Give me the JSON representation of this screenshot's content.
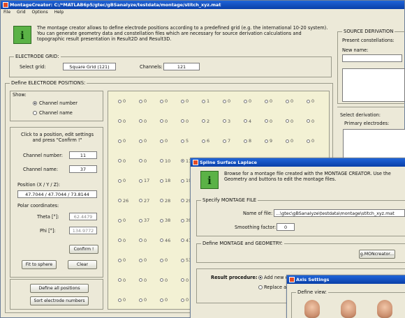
{
  "main_window": {
    "title": "MontageCreator: C:/*MATLAB6p5/gtec/gBSanalyze/testdata/montage/stitch_xyz.mat",
    "menu": [
      "File",
      "Grid",
      "Options",
      "Help"
    ],
    "info_text": "The montage creator allows to define electrode positions according to a predefined grid (e.g. the international 10-20 system). You can generate geometry data and constellation files which are necessary for source derivation calculations and topographic result presentation in Result2D and Result3D.",
    "electrode_grid": {
      "legend": "ELECTRODE GRID:",
      "select_grid_label": "Select grid:",
      "select_grid_value": "Square Grid (121)",
      "channels_label": "Channels:",
      "channels_value": "121"
    },
    "define_positions": {
      "legend": "Define ELECTRODE POSITIONS:",
      "show_label": "Show:",
      "show_options": [
        "Channel number",
        "Channel name"
      ],
      "show_selected": 0,
      "click_hint": "Click to a position, edit settings and press \"Confirm !\"",
      "channel_number_label": "Channel number:",
      "channel_number_value": "11",
      "channel_name_label": "Channel name:",
      "channel_name_value": "37",
      "position_label": "Position (X / Y / Z):",
      "position_value": "47.7044 / 47.7044 / 73.8144",
      "polar_label": "Polar coordinates:",
      "theta_label": "Theta [°]:",
      "theta_value": "62.4479",
      "phi_label": "Phi [°]:",
      "phi_value": "134.9772",
      "confirm_button": "Confirm !",
      "fit_sphere_button": "Fit to sphere",
      "clear_button": "Clear",
      "define_all_button": "Define all positions",
      "sort_button": "Sort electrode numbers"
    },
    "grid_rows": [
      [
        {
          "v": "0"
        },
        {
          "v": "0"
        },
        {
          "v": "0"
        },
        {
          "v": "0"
        },
        {
          "v": "1"
        },
        {
          "v": "0"
        },
        {
          "v": "0"
        },
        {
          "v": "0"
        },
        {
          "v": "0"
        },
        {
          "v": "0"
        }
      ],
      [
        {
          "v": "0"
        },
        {
          "v": "0"
        },
        {
          "v": "0"
        },
        {
          "v": "0"
        },
        {
          "v": "2"
        },
        {
          "v": "3"
        },
        {
          "v": "4"
        },
        {
          "v": "0"
        },
        {
          "v": "0"
        },
        {
          "v": "0"
        }
      ],
      [
        {
          "v": "0"
        },
        {
          "v": "0"
        },
        {
          "v": "0"
        },
        {
          "v": "5"
        },
        {
          "v": "6"
        },
        {
          "v": "7"
        },
        {
          "v": "8"
        },
        {
          "v": "9"
        },
        {
          "v": "0"
        },
        {
          "v": "0"
        }
      ],
      [
        {
          "v": "0"
        },
        {
          "v": "0"
        },
        {
          "v": "10"
        },
        {
          "v": "11",
          "on": true
        },
        {
          "v": "12"
        },
        {
          "v": "13"
        },
        {
          "v": "14"
        },
        {
          "v": "15"
        },
        {
          "v": "16"
        },
        {
          "v": "0"
        }
      ],
      [
        {
          "v": "0"
        },
        {
          "v": "17"
        },
        {
          "v": "18"
        },
        {
          "v": "19"
        }
      ],
      [
        {
          "v": "26"
        },
        {
          "v": "27"
        },
        {
          "v": "28"
        },
        {
          "v": "29"
        }
      ],
      [
        {
          "v": "0"
        },
        {
          "v": "37"
        },
        {
          "v": "38"
        },
        {
          "v": "39"
        }
      ],
      [
        {
          "v": "0"
        },
        {
          "v": "0"
        },
        {
          "v": "46"
        },
        {
          "v": "47"
        }
      ],
      [
        {
          "v": "0"
        },
        {
          "v": "0"
        },
        {
          "v": "0"
        },
        {
          "v": "53"
        }
      ],
      [
        {
          "v": "0"
        },
        {
          "v": "0"
        },
        {
          "v": "0"
        },
        {
          "v": "0"
        }
      ],
      [
        {
          "v": "0"
        },
        {
          "v": "0"
        },
        {
          "v": "0"
        },
        {
          "v": "0"
        }
      ]
    ],
    "source_derivation": {
      "legend": "SOURCE DERIVATION",
      "present_label": "Present constellations:",
      "new_name_label": "New name:",
      "select_label": "Select derivation:",
      "primary_label": "Primary electrodes:"
    }
  },
  "spline_window": {
    "title": "Spline Surface Laplace",
    "info_text": "Browse for a montage file created with the MONTAGE CREATOR. Use the Geometry and buttons to edit the montage files.",
    "montage_legend": "Specify MONTAGE FILE",
    "file_label": "Name of file:",
    "file_value": "...\\gtec\\gBSanalyze\\testdata\\montage\\stitch_xyz.mat",
    "smoothing_label": "Smoothing factor:",
    "smoothing_value": "0",
    "geometry_legend": "Define MONTAGE and GEOMETRY:",
    "creator_button": "g.MONcreator...",
    "result_label": "Result procedure:",
    "result_options": [
      "Add new ch",
      "Replace all"
    ]
  },
  "axis_window": {
    "title": "Axis Settings",
    "define_view_label": "Define view:"
  },
  "colors": {
    "title_blue": "#0a3fa8",
    "panel": "#ece9d8",
    "grid_bg": "#f3f1d4",
    "info_green": "#5bb246"
  }
}
